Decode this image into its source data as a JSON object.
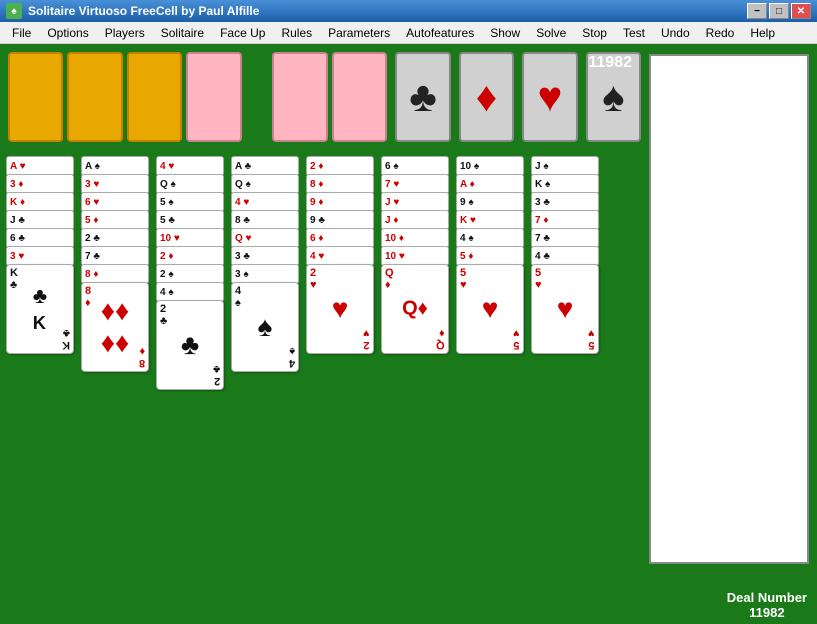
{
  "titlebar": {
    "title": "Solitaire Virtuoso   FreeCell   by Paul Alfille",
    "icon": "♠",
    "buttons": [
      "−",
      "□",
      "✕"
    ]
  },
  "menubar": {
    "items": [
      "File",
      "Options",
      "Players",
      "Solitaire",
      "Face Up",
      "Rules",
      "Parameters",
      "Autofeatures",
      "Show",
      "Solve",
      "Stop",
      "Test",
      "Undo",
      "Redo",
      "Help"
    ]
  },
  "game": {
    "score": "11982",
    "deal_label": "Deal Number",
    "deal_number": "11982",
    "suits": [
      "♣",
      "♦",
      "♥",
      "♠"
    ],
    "suit_colors": [
      "black",
      "red",
      "red",
      "black"
    ]
  },
  "columns": {
    "count": 8,
    "cards": [
      [
        "A♥",
        "3♦",
        "K♦",
        "J♣",
        "6♣",
        "3♥",
        "K♣"
      ],
      [
        "A♠",
        "3♥",
        "6♥",
        "5♦",
        "2♣",
        "7♣",
        "8♦",
        "8♦"
      ],
      [
        "4♥",
        "Q♠",
        "5♠",
        "5♣",
        "10♥",
        "2♦",
        "2♠",
        "4♠",
        "2♣"
      ],
      [
        "A♣",
        "Q♠",
        "4♥",
        "8♣",
        "Q♥",
        "3♣",
        "3♠",
        "4♠"
      ],
      [
        "2♦",
        "8♦",
        "9♦",
        "9♣",
        "6♦",
        "4♥",
        "2♥"
      ],
      [
        "6♠",
        "7♥",
        "J♥",
        "J♦",
        "10♦",
        "10♥",
        "Q♦"
      ],
      [
        "10♠",
        "A♦",
        "9♠",
        "K♥",
        "4♠",
        "5♦",
        "5♥"
      ],
      [
        "J♠",
        "K♠",
        "3♣",
        "7♦",
        "7♣",
        "4♣",
        "5♥"
      ]
    ]
  }
}
